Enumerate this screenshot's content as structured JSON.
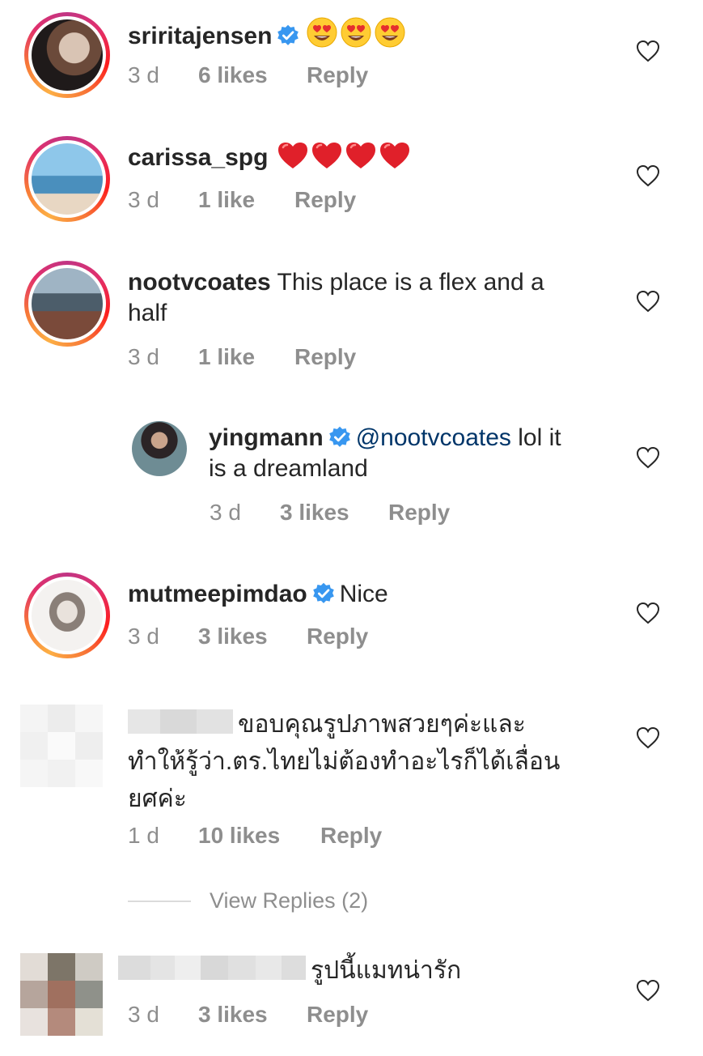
{
  "comments": [
    {
      "username": "sriritajensen",
      "verified": true,
      "text": "",
      "emoji": [
        "heart-eyes",
        "heart-eyes",
        "heart-eyes"
      ],
      "time": "3 d",
      "likes": "6 likes",
      "reply": "Reply"
    },
    {
      "username": "carissa_spg",
      "verified": false,
      "text": "",
      "emoji": [
        "red-heart",
        "red-heart",
        "red-heart",
        "red-heart"
      ],
      "time": "3 d",
      "likes": "1 like",
      "reply": "Reply"
    },
    {
      "username": "nootvcoates",
      "verified": false,
      "text": "This place is a flex and a",
      "text_line2": "half",
      "time": "3 d",
      "likes": "1 like",
      "reply": "Reply"
    },
    {
      "username": "yingmann",
      "verified": true,
      "mention": "@nootvcoates",
      "text": "lol it",
      "text_line2": "is a dreamland",
      "time": "3 d",
      "likes": "3 likes",
      "reply": "Reply"
    },
    {
      "username": "mutmeepimdao",
      "verified": true,
      "text": "Nice",
      "time": "3 d",
      "likes": "3 likes",
      "reply": "Reply"
    },
    {
      "text": "ขอบคุณรูปภาพสวยๆค่ะและ",
      "text_line2": "ทำให้รู้ว่า.ตร.ไทยไม่ต้องทำอะไรก็ได้เลื่อน",
      "text_line3": "ยศค่ะ",
      "time": "1 d",
      "likes": "10 likes",
      "reply": "Reply",
      "view_replies": "View Replies (2)"
    },
    {
      "text": "รูปนี้แมทน่ารัก",
      "time": "3 d",
      "likes": "3 likes",
      "reply": "Reply"
    }
  ],
  "colors": {
    "text": "#262626",
    "meta": "#8e8e8e",
    "mention": "#003569",
    "verified": "#3897f0",
    "heart": "#262626"
  }
}
